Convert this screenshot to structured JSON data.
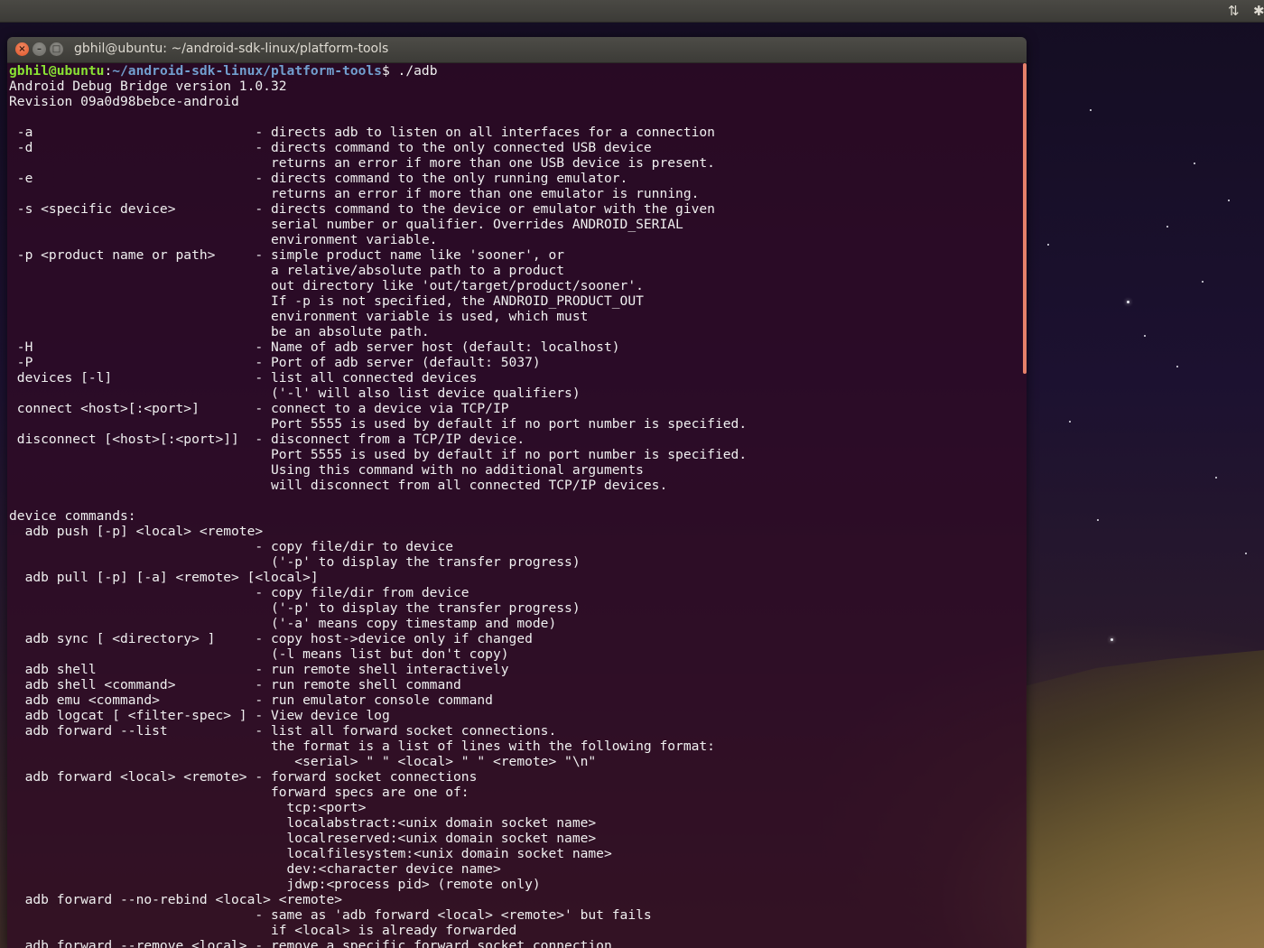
{
  "panel": {
    "network_icon": "network-transfer-icon",
    "bluetooth_icon": "bluetooth-icon"
  },
  "window": {
    "title": "gbhil@ubuntu: ~/android-sdk-linux/platform-tools",
    "buttons": {
      "close": "×",
      "minimize": "–",
      "maximize": "□"
    }
  },
  "prompt": {
    "user_host": "gbhil@ubuntu",
    "separator": ":",
    "path": "~/android-sdk-linux/platform-tools",
    "symbol": "$ ",
    "command": "./adb"
  },
  "output": "Android Debug Bridge version 1.0.32\nRevision 09a0d98bebce-android\n\n -a                            - directs adb to listen on all interfaces for a connection\n -d                            - directs command to the only connected USB device\n                                 returns an error if more than one USB device is present.\n -e                            - directs command to the only running emulator.\n                                 returns an error if more than one emulator is running.\n -s <specific device>          - directs command to the device or emulator with the given\n                                 serial number or qualifier. Overrides ANDROID_SERIAL\n                                 environment variable.\n -p <product name or path>     - simple product name like 'sooner', or\n                                 a relative/absolute path to a product\n                                 out directory like 'out/target/product/sooner'.\n                                 If -p is not specified, the ANDROID_PRODUCT_OUT\n                                 environment variable is used, which must\n                                 be an absolute path.\n -H                            - Name of adb server host (default: localhost)\n -P                            - Port of adb server (default: 5037)\n devices [-l]                  - list all connected devices\n                                 ('-l' will also list device qualifiers)\n connect <host>[:<port>]       - connect to a device via TCP/IP\n                                 Port 5555 is used by default if no port number is specified.\n disconnect [<host>[:<port>]]  - disconnect from a TCP/IP device.\n                                 Port 5555 is used by default if no port number is specified.\n                                 Using this command with no additional arguments\n                                 will disconnect from all connected TCP/IP devices.\n\ndevice commands:\n  adb push [-p] <local> <remote>\n                               - copy file/dir to device\n                                 ('-p' to display the transfer progress)\n  adb pull [-p] [-a] <remote> [<local>]\n                               - copy file/dir from device\n                                 ('-p' to display the transfer progress)\n                                 ('-a' means copy timestamp and mode)\n  adb sync [ <directory> ]     - copy host->device only if changed\n                                 (-l means list but don't copy)\n  adb shell                    - run remote shell interactively\n  adb shell <command>          - run remote shell command\n  adb emu <command>            - run emulator console command\n  adb logcat [ <filter-spec> ] - View device log\n  adb forward --list           - list all forward socket connections.\n                                 the format is a list of lines with the following format:\n                                    <serial> \" \" <local> \" \" <remote> \"\\n\"\n  adb forward <local> <remote> - forward socket connections\n                                 forward specs are one of:\n                                   tcp:<port>\n                                   localabstract:<unix domain socket name>\n                                   localreserved:<unix domain socket name>\n                                   localfilesystem:<unix domain socket name>\n                                   dev:<character device name>\n                                   jdwp:<process pid> (remote only)\n  adb forward --no-rebind <local> <remote>\n                               - same as 'adb forward <local> <remote>' but fails\n                                 if <local> is already forwarded\n  adb forward --remove <local> - remove a specific forward socket connection",
  "colors": {
    "terminal_bg": "#300a24",
    "prompt_user": "#8ae234",
    "prompt_path": "#729fcf",
    "scrollbar": "#e5806a",
    "close_button": "#e0552a"
  }
}
